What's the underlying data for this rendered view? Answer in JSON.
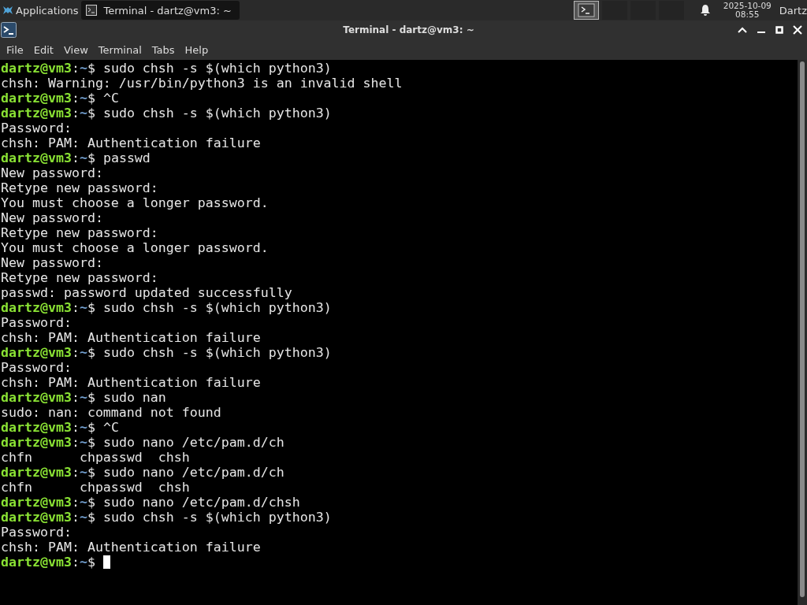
{
  "panel": {
    "apps_label": "Applications",
    "task": {
      "title": "Terminal - dartz@vm3: ~",
      "selected": true
    },
    "date": "2025-10-09",
    "time": "08:55",
    "user": "Dartz"
  },
  "window": {
    "title": "Terminal - dartz@vm3: ~"
  },
  "menu": [
    "File",
    "Edit",
    "View",
    "Terminal",
    "Tabs",
    "Help"
  ],
  "terminal": {
    "lines": [
      {
        "kind": "prompt",
        "user": "dartz@vm3",
        "separator": ":",
        "path": "~",
        "sign": "$",
        "text": "sudo chsh -s $(which python3)"
      },
      {
        "kind": "output",
        "text": "chsh: Warning: /usr/bin/python3 is an invalid shell"
      },
      {
        "kind": "prompt",
        "user": "dartz@vm3",
        "separator": ":",
        "path": "~",
        "sign": "$",
        "text": "^C"
      },
      {
        "kind": "prompt",
        "user": "dartz@vm3",
        "separator": ":",
        "path": "~",
        "sign": "$",
        "text": "sudo chsh -s $(which python3)"
      },
      {
        "kind": "output",
        "text": "Password:"
      },
      {
        "kind": "output",
        "text": "chsh: PAM: Authentication failure"
      },
      {
        "kind": "prompt",
        "user": "dartz@vm3",
        "separator": ":",
        "path": "~",
        "sign": "$",
        "text": "passwd"
      },
      {
        "kind": "output",
        "text": "New password:"
      },
      {
        "kind": "output",
        "text": "Retype new password:"
      },
      {
        "kind": "output",
        "text": "You must choose a longer password."
      },
      {
        "kind": "output",
        "text": "New password:"
      },
      {
        "kind": "output",
        "text": "Retype new password:"
      },
      {
        "kind": "output",
        "text": "You must choose a longer password."
      },
      {
        "kind": "output",
        "text": "New password:"
      },
      {
        "kind": "output",
        "text": "Retype new password:"
      },
      {
        "kind": "output",
        "text": "passwd: password updated successfully"
      },
      {
        "kind": "prompt",
        "user": "dartz@vm3",
        "separator": ":",
        "path": "~",
        "sign": "$",
        "text": "sudo chsh -s $(which python3)"
      },
      {
        "kind": "output",
        "text": "Password:"
      },
      {
        "kind": "output",
        "text": "chsh: PAM: Authentication failure"
      },
      {
        "kind": "prompt",
        "user": "dartz@vm3",
        "separator": ":",
        "path": "~",
        "sign": "$",
        "text": "sudo chsh -s $(which python3)"
      },
      {
        "kind": "output",
        "text": "Password:"
      },
      {
        "kind": "output",
        "text": "chsh: PAM: Authentication failure"
      },
      {
        "kind": "prompt",
        "user": "dartz@vm3",
        "separator": ":",
        "path": "~",
        "sign": "$",
        "text": "sudo nan"
      },
      {
        "kind": "output",
        "text": "sudo: nan: command not found"
      },
      {
        "kind": "prompt",
        "user": "dartz@vm3",
        "separator": ":",
        "path": "~",
        "sign": "$",
        "text": "^C"
      },
      {
        "kind": "prompt",
        "user": "dartz@vm3",
        "separator": ":",
        "path": "~",
        "sign": "$",
        "text": "sudo nano /etc/pam.d/ch"
      },
      {
        "kind": "output",
        "text": "chfn      chpasswd  chsh"
      },
      {
        "kind": "prompt",
        "user": "dartz@vm3",
        "separator": ":",
        "path": "~",
        "sign": "$",
        "text": "sudo nano /etc/pam.d/ch"
      },
      {
        "kind": "output",
        "text": "chfn      chpasswd  chsh"
      },
      {
        "kind": "prompt",
        "user": "dartz@vm3",
        "separator": ":",
        "path": "~",
        "sign": "$",
        "text": "sudo nano /etc/pam.d/chsh"
      },
      {
        "kind": "prompt",
        "user": "dartz@vm3",
        "separator": ":",
        "path": "~",
        "sign": "$",
        "text": "sudo chsh -s $(which python3)"
      },
      {
        "kind": "output",
        "text": "Password:"
      },
      {
        "kind": "output",
        "text": "chsh: PAM: Authentication failure"
      },
      {
        "kind": "prompt",
        "user": "dartz@vm3",
        "separator": ":",
        "path": "~",
        "sign": "$",
        "cursor": true
      }
    ]
  }
}
